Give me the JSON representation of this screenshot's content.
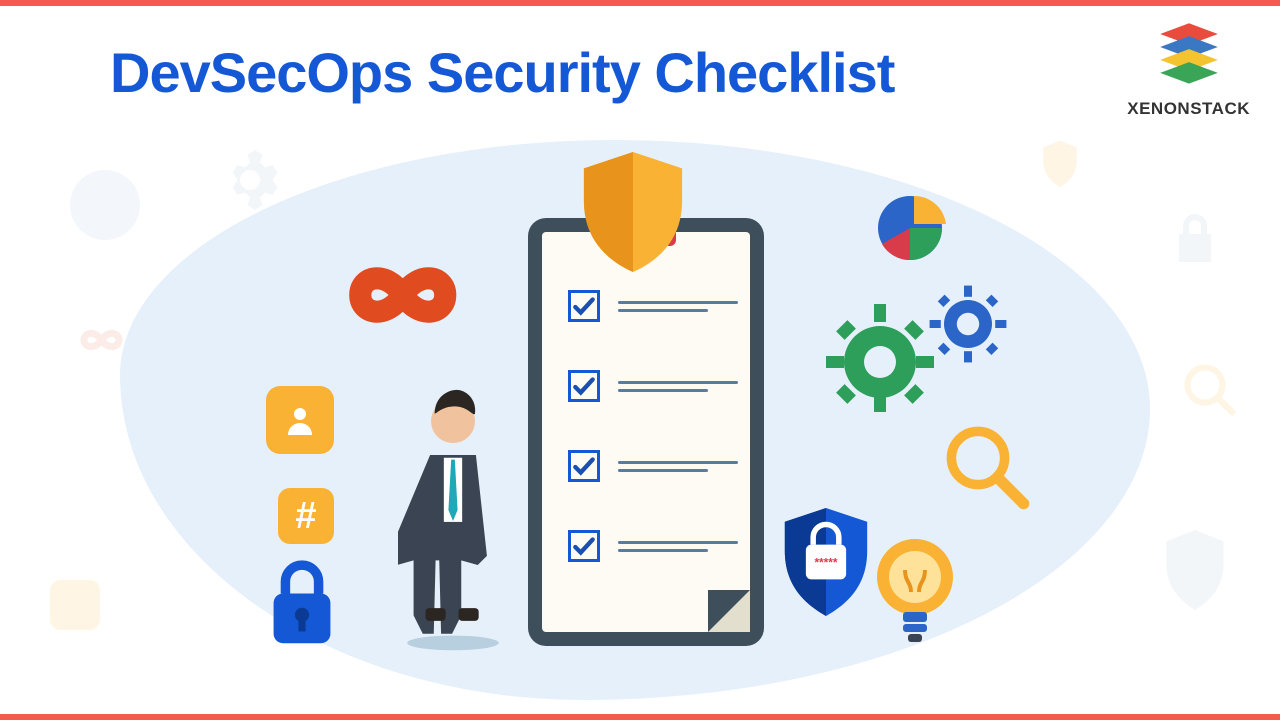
{
  "title": "DevSecOps Security Checklist",
  "brand": "XENONSTACK",
  "hash_symbol": "#",
  "checklist_items": 4,
  "colors": {
    "accent": "#F45B4E",
    "title": "#1558D6",
    "blob": "#E6F0FA",
    "orange": "#F9B233",
    "green": "#2E9E5B",
    "blue": "#2B65C7"
  },
  "icons": [
    "shield",
    "infinity",
    "user",
    "hash",
    "padlock",
    "pie-chart",
    "gears",
    "magnifier",
    "security-shield",
    "lightbulb"
  ]
}
